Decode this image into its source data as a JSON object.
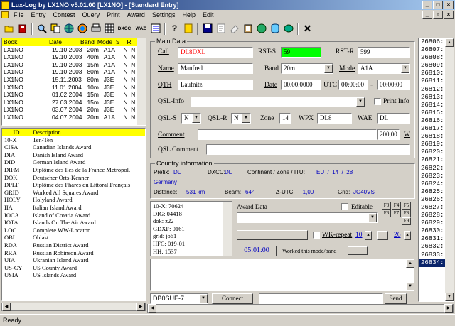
{
  "window": {
    "title": "Lux-Log by LX1NO v5.01.00 [LX1NO] - [Standard Entry]"
  },
  "menu": [
    "File",
    "Entry",
    "Contest",
    "Query",
    "Print",
    "Award",
    "Settings",
    "Help",
    "Edit"
  ],
  "toolbar": {
    "dxcc": "DXCC",
    "waz": "WAZ"
  },
  "logbook": {
    "headers": [
      "Book",
      "Date",
      "Band",
      "Mode",
      "S",
      "R"
    ],
    "rows": [
      [
        "LX1NO",
        "19.10.2003",
        "20m",
        "A1A",
        "N",
        "N"
      ],
      [
        "LX1NO",
        "19.10.2003",
        "40m",
        "A1A",
        "N",
        "N"
      ],
      [
        "LX1NO",
        "19.10.2003",
        "15m",
        "A1A",
        "N",
        "N"
      ],
      [
        "LX1NO",
        "19.10.2003",
        "80m",
        "A1A",
        "N",
        "N"
      ],
      [
        "LX1NO",
        "15.11.2003",
        "80m",
        "J3E",
        "N",
        "N"
      ],
      [
        "LX1NO",
        "11.01.2004",
        "10m",
        "J3E",
        "N",
        "N"
      ],
      [
        "LX1NO",
        "01.02.2004",
        "15m",
        "J3E",
        "N",
        "N"
      ],
      [
        "LX1NO",
        "27.03.2004",
        "15m",
        "J3E",
        "N",
        "N"
      ],
      [
        "LX1NO",
        "03.07.2004",
        "20m",
        "J3E",
        "N",
        "N"
      ],
      [
        "LX1NO",
        "04.07.2004",
        "20m",
        "A1A",
        "N",
        "N"
      ]
    ]
  },
  "awards": {
    "headers": [
      "ID",
      "Description"
    ],
    "rows": [
      [
        "10-X",
        "Ten-Ten"
      ],
      [
        "CISA",
        "Canadian Islands Award"
      ],
      [
        "DIA",
        "Danish Island Award"
      ],
      [
        "DID",
        "German Island Award"
      ],
      [
        "DIFM",
        "Diplôme des Iles de la France Metropol."
      ],
      [
        "DOK",
        "Deutscher Orts-Kenner"
      ],
      [
        "DPLF",
        "Diplôme des Phares du Littoral Français"
      ],
      [
        "GRID",
        "Worked All Squares Award"
      ],
      [
        "HOLY",
        "Holyland Award"
      ],
      [
        "IIA",
        "Italian Island Award"
      ],
      [
        "IOCA",
        "Island of Croatia Award"
      ],
      [
        "IOTA",
        "Islands On The Air Award"
      ],
      [
        "LOC",
        "Complete WW-Locator"
      ],
      [
        "OBL",
        "Oblast"
      ],
      [
        "RDA",
        "Russian District Award"
      ],
      [
        "RRA",
        "Russian Robinson Award"
      ],
      [
        "UIA",
        "Ukranian Island Award"
      ],
      [
        "US-CY",
        "US County Award"
      ],
      [
        "USIA",
        "US Islands Award"
      ]
    ]
  },
  "main": {
    "group_title": "Main Data",
    "call_label": "Call",
    "call_value": "DL8DXL",
    "rsts_label": "RST-S",
    "rsts_value": "59",
    "rstr_label": "RST-R",
    "rstr_value": "599",
    "name_label": "Name",
    "name_value": "Manfred",
    "band_label": "Band",
    "band_value": "20m",
    "mode_label": "Mode",
    "mode_value": "A1A",
    "qth_label": "QTH",
    "qth_value": "Laufnitz",
    "date_label": "Date",
    "date_value": "00.00.0000",
    "utc_label": "UTC",
    "utc_from": "00:00:00",
    "utc_dash": "-",
    "utc_to": "00:00:00",
    "qslinfo_label": "QSL-Info",
    "print_info": "Print Info",
    "qsls_label": "QSL-S",
    "qsls_value": "N",
    "qslr_label": "QSL-R",
    "qslr_value": "N",
    "zone_label": "Zone",
    "zone_value": "14",
    "wpx_label": "WPX",
    "wpx_value": "DL8",
    "wae_label": "WAE",
    "wae_value": "DL",
    "comment_label": "Comment",
    "comment_amount": "200,00",
    "comment_w": "W",
    "qslcomment_label": "QSL Comment"
  },
  "country": {
    "group_title": "Country information",
    "prefix_label": "Prefix:",
    "prefix_value": "DL",
    "dxcc_label": "DXCC:",
    "dxcc_value": "DL",
    "cont_label": "Continent / Zone / ITU:",
    "cont_value": "EU  /  14  /  28",
    "country_name": "Germany",
    "dist_label": "Distance:",
    "dist_value": "531 km",
    "beam_label": "Beam:",
    "beam_value": "64°",
    "dutc_label": "Δ-UTC:",
    "dutc_value": "+1,00",
    "grid_label": "Grid:",
    "grid_value": "JO40VS"
  },
  "award_info": [
    "10-X: 70624",
    "DIG: 04418",
    "dok: z22",
    "GDXF: 0161",
    "grid: jo61",
    "HFC: 019-01",
    "HH: 1537"
  ],
  "award_data": {
    "label": "Award Data",
    "editable": "Editable",
    "fkeys": [
      "F3",
      "F4",
      "F5",
      "F6",
      "F7",
      "F8",
      "F9"
    ],
    "wkrepeat": "WK-repeat",
    "wk_val1": "10",
    "wk_val2": "26",
    "timer": "05:01:00",
    "worked_label": "Worked this mode/band"
  },
  "cluster": {
    "node": "DB0SUE-7",
    "connect": "Connect",
    "send": "Send"
  },
  "qso_numbers": [
    "26806:",
    "26807:",
    "26808:",
    "26809:",
    "26810:",
    "26811:",
    "26812:",
    "26813:",
    "26814:",
    "26815:",
    "26816:",
    "26817:",
    "26818:",
    "26819:",
    "26820:",
    "26821:",
    "26822:",
    "26823:",
    "26824:",
    "26825:",
    "26826:",
    "26827:",
    "26828:",
    "26829:",
    "26830:",
    "26831:",
    "26832:",
    "26833:",
    "26834:"
  ],
  "status": {
    "text": "Ready"
  },
  "colors": {
    "title_start": "#0a246a",
    "title_end": "#a6caf0",
    "highlight_yellow": "#ffff00",
    "rst_green": "#00ff00",
    "call_red": "#ff0000",
    "info_blue": "#0000c0",
    "selection": "#0a246a"
  }
}
